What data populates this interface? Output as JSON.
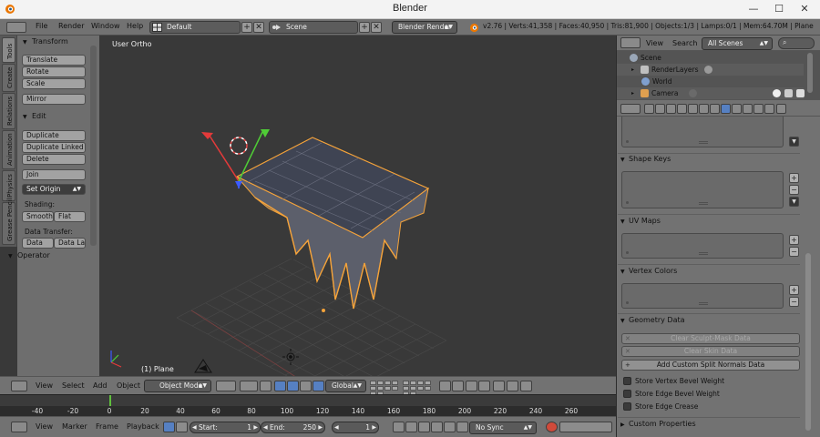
{
  "window": {
    "title": "Blender",
    "min_glyph": "—",
    "max_glyph": "☐",
    "close_glyph": "✕"
  },
  "info_header": {
    "menus": [
      "File",
      "Render",
      "Window",
      "Help"
    ],
    "screen_layout": "Default",
    "scene": "Scene",
    "render_engine": "Blender Render",
    "stats": "v2.76 | Verts:41,358 | Faces:40,950 | Tris:81,900 | Objects:1/3 | Lamps:0/1 | Mem:64.70M | Plane",
    "add_glyph": "+",
    "remove_glyph": "✕"
  },
  "tool_shelf": {
    "tabs": [
      "Tools",
      "Create",
      "Relations",
      "Animation",
      "Physics",
      "Grease Pencil"
    ],
    "transform": {
      "title": "Transform",
      "buttons": [
        "Translate",
        "Rotate",
        "Scale"
      ],
      "mirror": "Mirror"
    },
    "edit": {
      "title": "Edit",
      "buttons": [
        "Duplicate",
        "Duplicate Linked",
        "Delete"
      ],
      "join": "Join",
      "set_origin": "Set Origin",
      "shading_label": "Shading:",
      "smooth": "Smooth",
      "flat": "Flat",
      "data_transfer_label": "Data Transfer:",
      "data": "Data",
      "data_layers": "Data La"
    },
    "operator": {
      "title": "Operator"
    }
  },
  "viewport": {
    "view_label": "User Ortho",
    "object_label": "(1) Plane"
  },
  "view3d_header": {
    "menus": [
      "View",
      "Select",
      "Add",
      "Object"
    ],
    "mode": "Object Mode",
    "orientation": "Global"
  },
  "timeline": {
    "ticks": [
      "-40",
      "-20",
      "0",
      "20",
      "40",
      "60",
      "80",
      "100",
      "120",
      "140",
      "160",
      "180",
      "200",
      "220",
      "240",
      "260"
    ],
    "current_frame_marker": "1"
  },
  "timeline_header": {
    "menus": [
      "View",
      "Marker",
      "Frame",
      "Playback"
    ],
    "start_label": "Start:",
    "start_value": "1",
    "end_label": "End:",
    "end_value": "250",
    "current_frame": "1",
    "sync": "No Sync"
  },
  "outliner": {
    "menus": [
      "View",
      "Search"
    ],
    "display_mode": "All Scenes",
    "rows": [
      {
        "label": "Scene",
        "icon": "scene-icon"
      },
      {
        "label": "RenderLayers",
        "icon": "render-layers-icon"
      },
      {
        "label": "World",
        "icon": "world-icon"
      },
      {
        "label": "Camera",
        "icon": "camera-icon"
      }
    ]
  },
  "properties": {
    "context": "object-data",
    "shape_keys": "Shape Keys",
    "uv_maps": "UV Maps",
    "vertex_colors": "Vertex Colors",
    "geometry_data": {
      "title": "Geometry Data",
      "clear_sculpt_mask": "Clear Sculpt-Mask Data",
      "clear_skin": "Clear Skin Data",
      "add_custom_split_normals": "Add Custom Split Normals Data",
      "store_vertex_bevel_weight": "Store Vertex Bevel Weight",
      "store_edge_bevel_weight": "Store Edge Bevel Weight",
      "store_edge_crease": "Store Edge Crease"
    },
    "custom_properties": "Custom Properties",
    "add_glyph": "+",
    "remove_glyph": "−",
    "down_glyph": "▼",
    "x_glyph": "✕"
  },
  "colors": {
    "header": "#727272",
    "viewport_bg": "#393939",
    "selection_orange": "#f5a33a",
    "active_blue": "#5680c2",
    "current_frame_green": "#5fbf3c"
  }
}
